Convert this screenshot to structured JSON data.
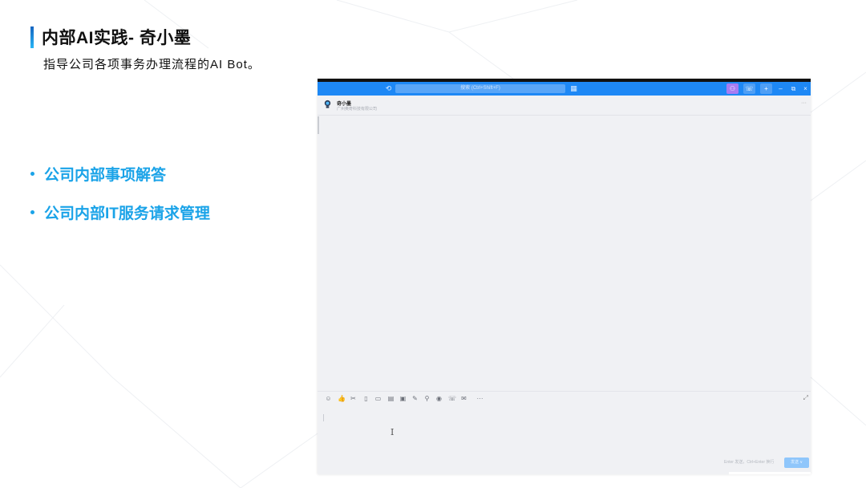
{
  "slide": {
    "title": "内部AI实践- 奇小墨",
    "subtitle": "指导公司各项事务办理流程的AI Bot。",
    "bullets": [
      "公司内部事项解答",
      "公司内部IT服务请求管理"
    ],
    "accent_color": "#1aa3e8"
  },
  "app": {
    "titlebar": {
      "color": "#1e88f5",
      "history_icon": "history-icon",
      "search_placeholder": "搜索 (Ctrl+Shift+F)",
      "qr_icon": "qr-code-icon",
      "buttons": [
        "app-button-1",
        "app-button-2",
        "add-button"
      ],
      "window_controls": [
        "minimize",
        "restore",
        "close"
      ]
    },
    "chat": {
      "name": "奇小墨",
      "org": "广州奥奇科技有限公司",
      "more_label": "···"
    },
    "toolbar": {
      "icons": [
        "emoji-icon",
        "thumbs-up-icon",
        "scissors-icon",
        "file-icon",
        "folder-icon",
        "calendar-icon",
        "note-icon",
        "edit-icon",
        "location-icon",
        "palette-icon",
        "phone-icon",
        "mail-icon",
        "more-icon"
      ]
    },
    "input": {
      "send_hint": "Enter 发送，Ctrl+Enter 换行",
      "send_label": "发送"
    }
  }
}
